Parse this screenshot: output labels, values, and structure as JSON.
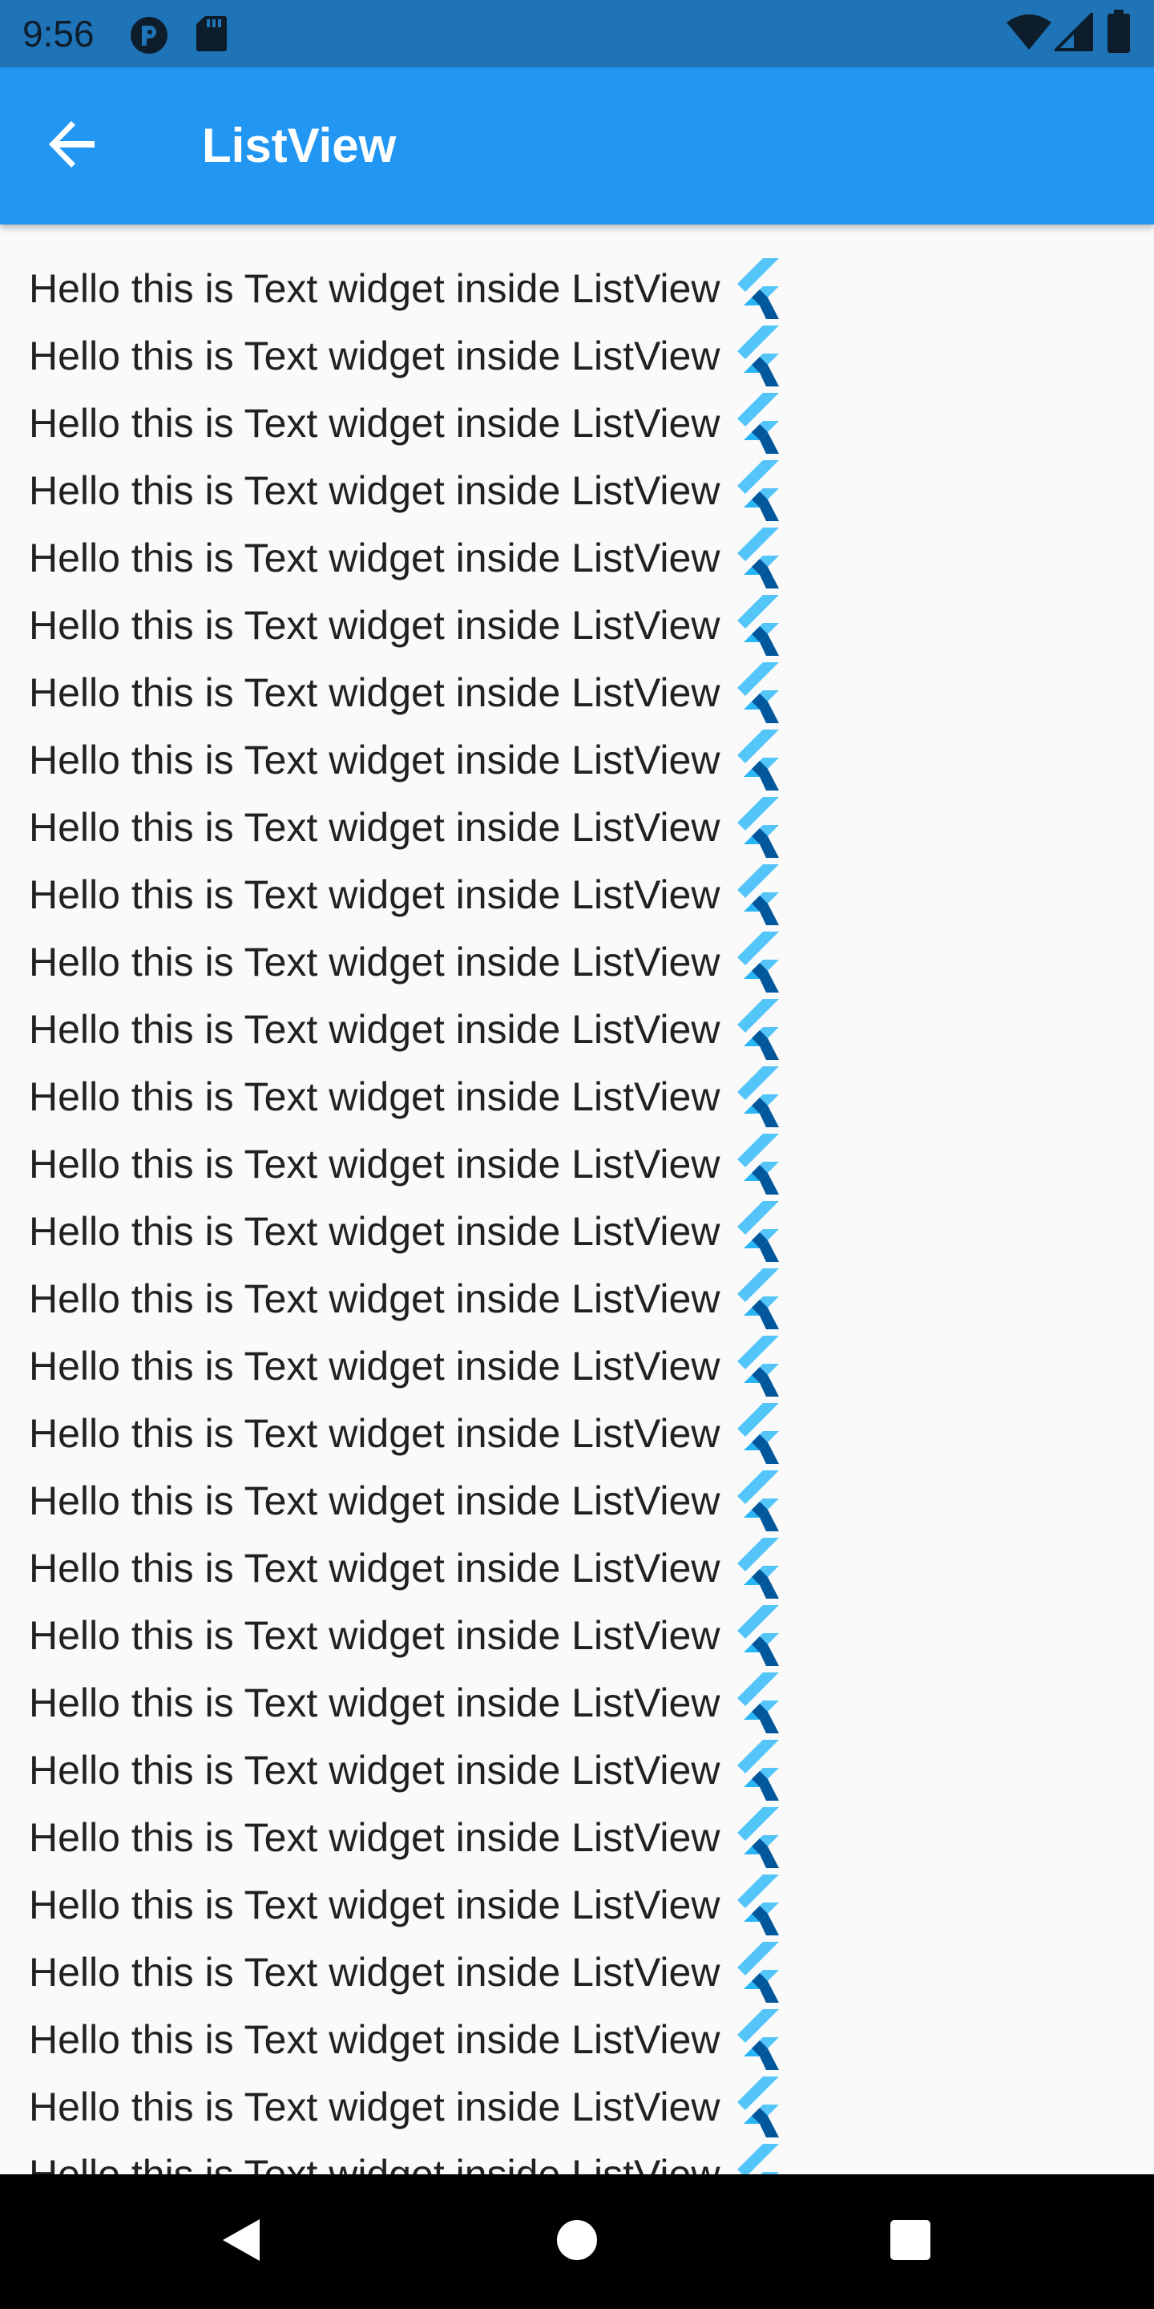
{
  "status_bar": {
    "time": "9:56",
    "left_icons": [
      "notification-app-icon",
      "sd-card-icon"
    ],
    "right_icons": [
      "wifi-icon",
      "cellular-signal-icon",
      "battery-icon"
    ]
  },
  "app_bar": {
    "title": "ListView",
    "back_icon": "arrow-back-icon",
    "color": "#2196f3"
  },
  "list": {
    "item_icon": "flutter-logo-icon",
    "items": [
      "Hello this is Text widget inside ListView",
      "Hello this is Text widget inside ListView",
      "Hello this is Text widget inside ListView",
      "Hello this is Text widget inside ListView",
      "Hello this is Text widget inside ListView",
      "Hello this is Text widget inside ListView",
      "Hello this is Text widget inside ListView",
      "Hello this is Text widget inside ListView",
      "Hello this is Text widget inside ListView",
      "Hello this is Text widget inside ListView",
      "Hello this is Text widget inside ListView",
      "Hello this is Text widget inside ListView",
      "Hello this is Text widget inside ListView",
      "Hello this is Text widget inside ListView",
      "Hello this is Text widget inside ListView",
      "Hello this is Text widget inside ListView",
      "Hello this is Text widget inside ListView",
      "Hello this is Text widget inside ListView",
      "Hello this is Text widget inside ListView",
      "Hello this is Text widget inside ListView",
      "Hello this is Text widget inside ListView",
      "Hello this is Text widget inside ListView",
      "Hello this is Text widget inside ListView",
      "Hello this is Text widget inside ListView",
      "Hello this is Text widget inside ListView",
      "Hello this is Text widget inside ListView",
      "Hello this is Text widget inside ListView",
      "Hello this is Text widget inside ListView",
      "Hello this is Text widget inside ListView"
    ]
  },
  "nav_bar": {
    "buttons": [
      "back-triangle-icon",
      "home-circle-icon",
      "recents-square-icon"
    ]
  }
}
